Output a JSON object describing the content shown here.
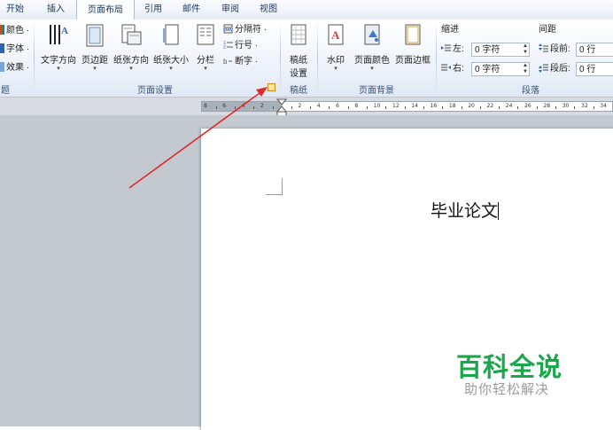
{
  "tabs": [
    {
      "label": "开始"
    },
    {
      "label": "插入"
    },
    {
      "label": "页面布局"
    },
    {
      "label": "引用"
    },
    {
      "label": "邮件"
    },
    {
      "label": "审阅"
    },
    {
      "label": "视图"
    }
  ],
  "theme_group": {
    "items": [
      {
        "label": "颜色 ·"
      },
      {
        "label": "字体 ·"
      },
      {
        "label": "效果 ·"
      }
    ],
    "group_label": "题"
  },
  "page_setup": {
    "buttons": [
      {
        "label": "文字方向"
      },
      {
        "label": "页边距"
      },
      {
        "label": "纸张方向"
      },
      {
        "label": "纸张大小"
      },
      {
        "label": "分栏"
      }
    ],
    "small": [
      {
        "label": "分隔符 ·"
      },
      {
        "label": "行号 ·"
      },
      {
        "label": "断字 ·"
      }
    ],
    "group_label": "页面设置"
  },
  "manuscript": {
    "line1": "稿纸",
    "line2": "设置",
    "group_label": "稿纸"
  },
  "page_background": {
    "buttons": [
      {
        "label": "水印"
      },
      {
        "label": "页面颜色"
      },
      {
        "label": "页面边框"
      }
    ],
    "group_label": "页面背景"
  },
  "paragraph": {
    "indent_title": "缩进",
    "spacing_title": "间距",
    "left_label": "左:",
    "left_value": "0 字符",
    "right_label": "右:",
    "right_value": "0 字符",
    "before_label": "段前:",
    "before_value": "0 行",
    "after_label": "段后:",
    "after_value": "0 行",
    "group_label": "段落"
  },
  "ruler": {
    "labels": [
      "8",
      "6",
      "4",
      "2",
      "",
      "2",
      "4",
      "6",
      "8",
      "10",
      "12",
      "14",
      "16",
      "18",
      "20",
      "22",
      "24",
      "26",
      "28",
      "30",
      "32",
      "34"
    ]
  },
  "document": {
    "title": "毕业论文"
  },
  "watermark": {
    "main": "百科全说",
    "sub": "助你轻松解决"
  },
  "colors": {
    "annotation_arrow": "#e0282c",
    "watermark_green": "#1aa64a",
    "watermark_grey": "#9a9a9a"
  }
}
